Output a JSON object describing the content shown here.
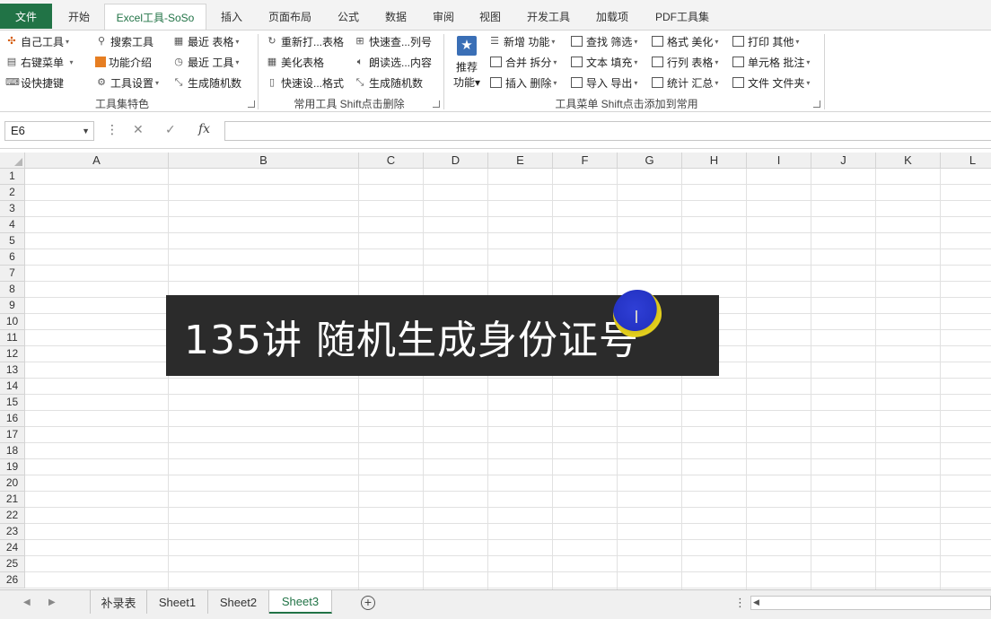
{
  "tabs": {
    "file": "文件",
    "items": [
      "开始",
      "Excel工具-SoSo",
      "插入",
      "页面布局",
      "公式",
      "数据",
      "审阅",
      "视图",
      "开发工具",
      "加载项",
      "PDF工具集"
    ],
    "active_index": 1
  },
  "ribbon": {
    "group1": {
      "items": [
        "自己工具",
        "右键菜单",
        "设快捷键",
        "搜索工具",
        "功能介绍",
        "工具设置",
        "最近 表格",
        "最近 工具",
        "生成随机数"
      ],
      "label": "工具集特色"
    },
    "group2": {
      "items": [
        "重新打...表格",
        "美化表格",
        "快速设...格式",
        "快速查...列号",
        "朗读选...内容",
        "生成随机数"
      ],
      "label": "常用工具 Shift点击删除"
    },
    "group3": {
      "big_button": [
        "推荐",
        "功能"
      ],
      "items": [
        "新增 功能",
        "合并 拆分",
        "插入 删除",
        "查找 筛选",
        "文本 填充",
        "导入 导出",
        "格式 美化",
        "行列 表格",
        "统计 汇总",
        "打印 其他",
        "单元格 批注",
        "文件 文件夹"
      ],
      "label": "工具菜单 Shift点击添加到常用"
    }
  },
  "formula_bar": {
    "name_box": "E6",
    "cancel_icon": "✕",
    "enter_icon": "✓",
    "fx_label": "fx",
    "value": ""
  },
  "grid": {
    "columns": [
      "A",
      "B",
      "C",
      "D",
      "E",
      "F",
      "G",
      "H",
      "I",
      "J",
      "K",
      "L"
    ],
    "rows": [
      "1",
      "2",
      "3",
      "4",
      "5",
      "6",
      "7",
      "8",
      "9",
      "10",
      "11",
      "12",
      "13",
      "14",
      "15",
      "16",
      "17",
      "18",
      "19",
      "20",
      "21",
      "22",
      "23",
      "24",
      "25",
      "26"
    ]
  },
  "overlay": {
    "title": "135讲 随机生成身份证号"
  },
  "sheets": {
    "tabs": [
      "补录表",
      "Sheet1",
      "Sheet2",
      "Sheet3"
    ],
    "active_index": 3,
    "add_label": "+"
  },
  "colors": {
    "accent": "#217346",
    "banner_bg": "#2b2b2b"
  }
}
